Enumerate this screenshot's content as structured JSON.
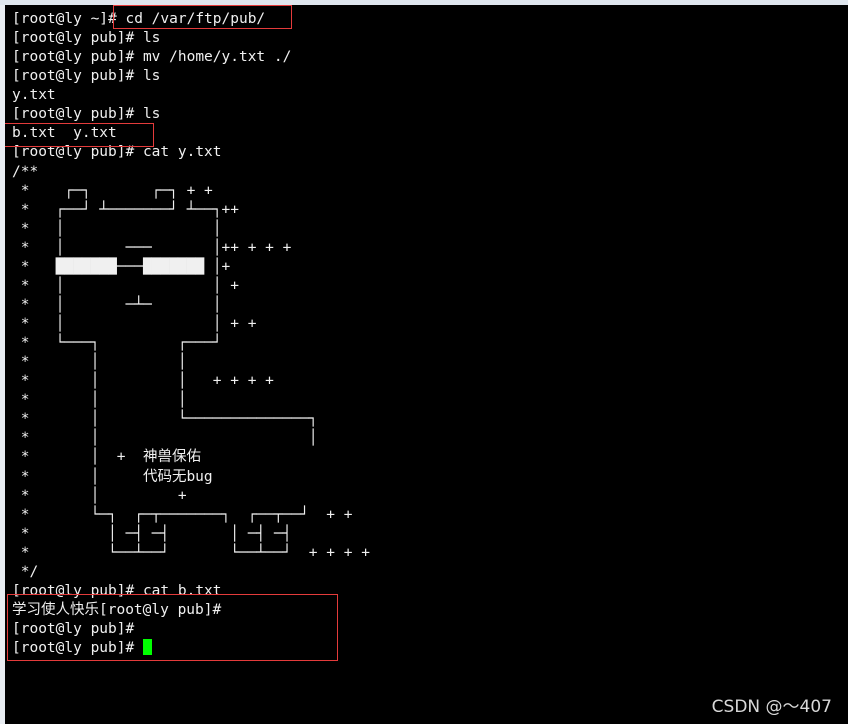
{
  "terminal": {
    "lines": [
      "[root@ly ~]# cd /var/ftp/pub/",
      "[root@ly pub]# ls",
      "[root@ly pub]# mv /home/y.txt ./",
      "[root@ly pub]# ls",
      "y.txt",
      "[root@ly pub]# ls",
      "b.txt  y.txt",
      "[root@ly pub]# cat y.txt",
      "/**",
      " *    ┌─┐       ┌─┐ + +",
      " *   ┌──┘ ┴───────┘ ┴──┐++",
      " *   │                 │",
      " *   │       ───       │++ + + +",
      " *   ███████───███████ │+",
      " *   │                 │ +",
      " *   │       ─┴─       │",
      " *   │                 │ + +",
      " *   └───┐         ┌───┘",
      " *       │         │",
      " *       │         │   + + + +",
      " *       │         │",
      " *       │         └──────────────┐",
      " *       │                        │",
      " *       │  +  神兽保佑",
      " *       │     代码无bug",
      " *       │         +",
      " *       └─┐  ┌─┬───────┐  ┌──┬──┘  + +",
      " *         │ ─┤ ─┤       │ ─┤ ─┤",
      " *         └──┴──┘       └──┴──┘  + + + +",
      " */",
      "[root@ly pub]# cat b.txt",
      "学习使人快乐[root@ly pub]#",
      "[root@ly pub]#",
      "[root@ly pub]# "
    ]
  },
  "watermark": "CSDN @～407",
  "colors": {
    "background": "#000000",
    "text": "#f0f0f0",
    "cursor": "#00ff00",
    "highlight_box": "#e43b3b"
  }
}
